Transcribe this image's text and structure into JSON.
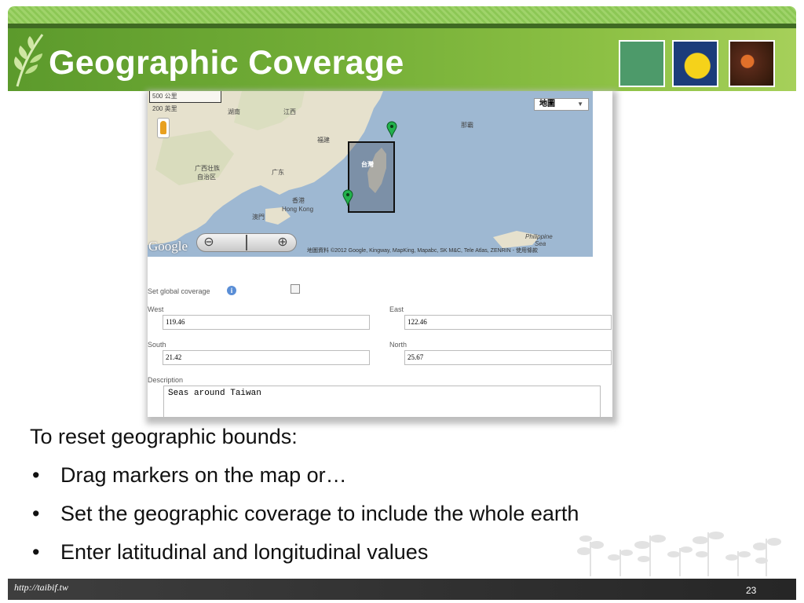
{
  "slide": {
    "title": "Geographic Coverage",
    "footer_url": "http://taibif.tw",
    "page_number": "23"
  },
  "map": {
    "map_type": "地圖",
    "scale_top": "500 公里",
    "scale_bottom": "200 英里",
    "labels": {
      "hunan": "湖南",
      "jiangxi": "江西",
      "fujian": "福建",
      "guangxi": "广西壮族",
      "guangxi2": "自治区",
      "guangdong": "广东",
      "hongkong_zh": "香港",
      "hongkong_en": "Hong Kong",
      "macau": "澳門",
      "taiwan": "台灣",
      "naha": "那霸",
      "philippine": "Philippine",
      "sea": "Sea"
    },
    "logo": "Google",
    "attribution": "地圖資料 ©2012 Google, Kingway, MapKing, Mapabc, SK M&C, Tele Atlas, ZENRIN - 使用條款",
    "zoom_out": "⊖",
    "zoom_in": "⊕"
  },
  "form": {
    "global_label": "Set global coverage",
    "info_icon": "i",
    "west_label": "West",
    "west_value": "119.46",
    "east_label": "East",
    "east_value": "122.46",
    "south_label": "South",
    "south_value": "21.42",
    "north_label": "North",
    "north_value": "25.67",
    "description_label": "Description",
    "description_value": "Seas around Taiwan"
  },
  "body": {
    "heading": "To reset geographic bounds:",
    "bullets": [
      "Drag markers on the map or…",
      "Set the geographic coverage to include the whole earth",
      "Enter latitudinal and longitudinal values"
    ],
    "bullet_glyph": "•"
  },
  "colors": {
    "header_green": "#72ad36",
    "sea": "#9eb8d2",
    "land": "#e6e1cd",
    "marker": "#22b14c",
    "footer": "#2f2f2f"
  }
}
